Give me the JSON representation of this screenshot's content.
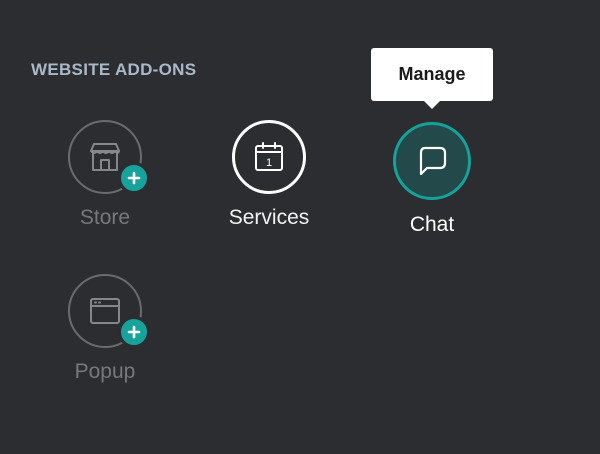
{
  "section": {
    "title": "WEBSITE ADD-ONS"
  },
  "addons": [
    {
      "label": "Store",
      "state": "inactive",
      "icon": "store-icon"
    },
    {
      "label": "Services",
      "state": "active",
      "icon": "calendar-icon",
      "icon_text": "1"
    },
    {
      "label": "Chat",
      "state": "selected",
      "icon": "chat-bubble-icon"
    },
    {
      "label": "Popup",
      "state": "inactive",
      "icon": "popup-window-icon"
    }
  ],
  "tooltip": {
    "text": "Manage"
  },
  "colors": {
    "background": "#2c2d30",
    "accent": "#17a39b",
    "section_title": "#aab8c8",
    "inactive_label": "#77787d",
    "active_label": "#f2f2f2"
  }
}
